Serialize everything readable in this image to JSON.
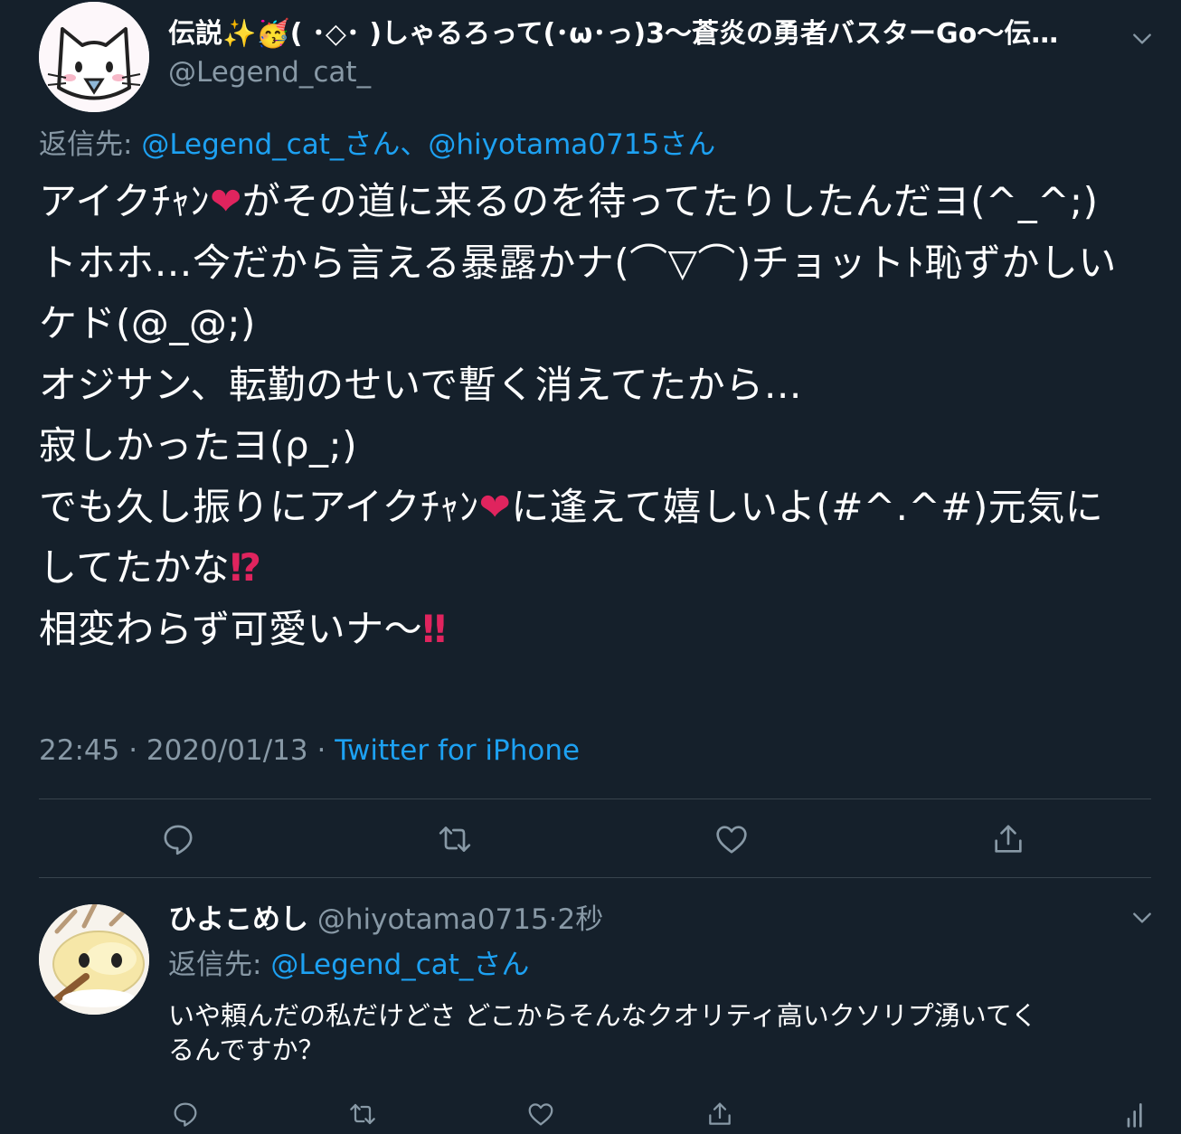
{
  "main_tweet": {
    "display_name": "伝説✨🥳( ･◇･ )しゃるろって(･ω･っ)3〜蒼炎の勇者バスターGo〜伝…",
    "handle": "@Legend_cat_",
    "reply_label": "返信先: ",
    "reply_to": "@Legend_cat_さん、@hiyotama0715さん",
    "lines": [
      {
        "parts": [
          {
            "t": "アイクﾁｬﾝ"
          },
          {
            "t": "❤",
            "c": "red"
          },
          {
            "t": "がその道に来るのを待ってたりしたんだヨ(^_^;)"
          }
        ]
      },
      {
        "parts": [
          {
            "t": "トホホ…今だから言える暴露かナ(⌒▽⌒)チョットﾄ恥ずかしい"
          }
        ]
      },
      {
        "parts": [
          {
            "t": "ケド(@_@;)"
          }
        ]
      },
      {
        "parts": [
          {
            "t": "オジサン、転勤のせいで暫く消えてたから…"
          }
        ]
      },
      {
        "parts": [
          {
            "t": "寂しかったヨ(ρ_;)"
          }
        ]
      },
      {
        "parts": [
          {
            "t": "でも久し振りにアイクﾁｬﾝ"
          },
          {
            "t": "❤",
            "c": "red"
          },
          {
            "t": "に逢えて嬉しいよ(#^.^#)元気に"
          }
        ]
      },
      {
        "parts": [
          {
            "t": "してたかな"
          },
          {
            "t": "⁉",
            "c": "excl"
          }
        ]
      },
      {
        "parts": [
          {
            "t": "相変わらず可愛いナ〜"
          },
          {
            "t": "‼",
            "c": "excl"
          }
        ]
      }
    ],
    "time": "22:45",
    "date": "2020/01/13",
    "sep": "·",
    "source": "Twitter for iPhone"
  },
  "reply_tweet": {
    "display_name": "ひよこめし",
    "handle": "@hiyotama0715",
    "sep": "·",
    "time_ago": "2秒",
    "reply_label": "返信先: ",
    "reply_to": "@Legend_cat_さん",
    "text_line1": "いや頼んだの私だけどさ どこからそんなクオリティ高いクソリプ湧いてく",
    "text_line2": "るんですか？"
  },
  "colors": {
    "background": "#15202b",
    "accent": "#1da1f2",
    "muted": "#8899a6",
    "divider": "#38444d",
    "heart": "#e0245e"
  },
  "icons": [
    "chevron-down-icon",
    "reply-icon",
    "retweet-icon",
    "like-icon",
    "share-icon",
    "analytics-icon"
  ]
}
